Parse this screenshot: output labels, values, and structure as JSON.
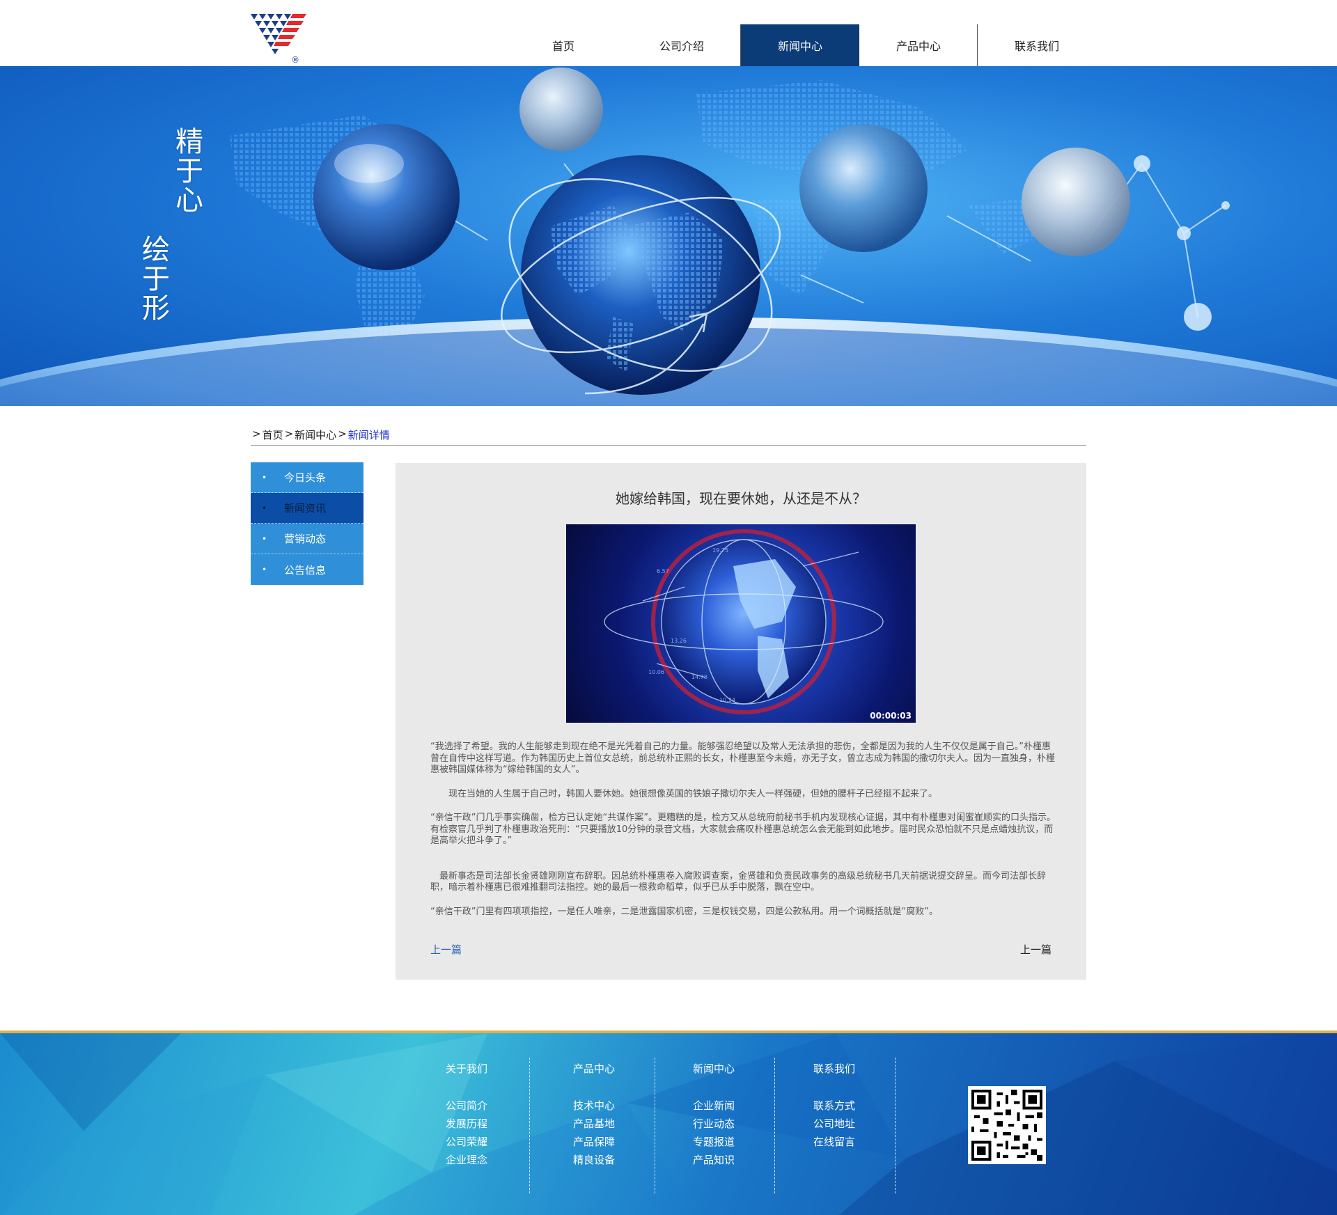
{
  "nav": {
    "items": [
      {
        "label": "首页",
        "active": false
      },
      {
        "label": "公司介绍",
        "active": false
      },
      {
        "label": "新闻中心",
        "active": true
      },
      {
        "label": "产品中心",
        "active": false
      },
      {
        "label": "联系我们",
        "active": false
      }
    ]
  },
  "banner": {
    "slogan_1": "精于心",
    "slogan_2": "绘于形"
  },
  "breadcrumb": {
    "items": [
      "首页",
      "新闻中心",
      "新闻详情"
    ],
    "separator": ">"
  },
  "sidebar": {
    "items": [
      {
        "label": "今日头条",
        "active": false
      },
      {
        "label": "新闻资讯",
        "active": true
      },
      {
        "label": "营销动态",
        "active": false
      },
      {
        "label": "公告信息",
        "active": false
      }
    ]
  },
  "article": {
    "title": "她嫁给韩国，现在要休她，从还是不从？",
    "image_timestamp": "00:00:03",
    "paragraphs": [
      "“我选择了希望。我的人生能够走到现在绝不是光凭着自己的力量。能够强忍绝望以及常人无法承担的悲伤，全都是因为我的人生不仅仅是属于自己。”朴槿惠曾在自传中这样写道。作为韩国历史上首位女总统，前总统朴正熙的长女，朴槿惠至今未婚，亦无子女，曾立志成为韩国的撒切尔夫人。因为一直独身，朴槿惠被韩国媒体称为“嫁给韩国的女人”。",
      "　　现在当她的人生属于自己时，韩国人要休她。她很想像英国的铁娘子撒切尔夫人一样强硬，但她的腰杆子已经挺不起来了。",
      "“亲信干政”门几乎事实确凿，检方已认定她“共谋作案”。更糟糕的是，检方又从总统府前秘书手机内发现核心证据，其中有朴槿惠对闺蜜崔顺实的口头指示。有检察官几乎判了朴槿惠政治死刑：“只要播放10分钟的录音文档，大家就会痛叹朴槿惠总统怎么会无能到如此地步。届时民众恐怕就不只是点蜡烛抗议，而是高举火把斗争了。”",
      "　最新事态是司法部长金贤雄刚刚宣布辞职。因总统朴槿惠卷入腐败调查案，金贤雄和负责民政事务的高级总统秘书几天前据说提交辞呈。而今司法部长辞职，暗示着朴槿惠已很难推翻司法指控。她的最后一根救命稻草，似乎已从手中脱落，飘在空中。",
      "“亲信干政”门里有四项项指控，一是任人唯亲，二是泄露国家机密，三是权钱交易，四是公款私用。用一个词概括就是“腐败”。"
    ],
    "prev_label": "上一篇",
    "next_label": "上一篇"
  },
  "footer": {
    "columns": [
      {
        "title": "关于我们",
        "links": [
          "公司简介",
          "发展历程",
          "公司荣耀",
          "企业理念"
        ]
      },
      {
        "title": "产品中心",
        "links": [
          "技术中心",
          "产品基地",
          "产品保障",
          "精良设备"
        ]
      },
      {
        "title": "新闻中心",
        "links": [
          "企业新闻",
          "行业动态",
          "专题报道",
          "产品知识"
        ]
      },
      {
        "title": "联系我们",
        "links": [
          "联系方式",
          "公司地址",
          "在线留言"
        ]
      }
    ]
  },
  "colors": {
    "nav_active": "#0b3c78",
    "sidebar": "#2f8fd8",
    "sidebar_active": "#0b4ea8",
    "breadcrumb_current": "#1d2fd4",
    "footer_accent": "#e0b24a"
  }
}
